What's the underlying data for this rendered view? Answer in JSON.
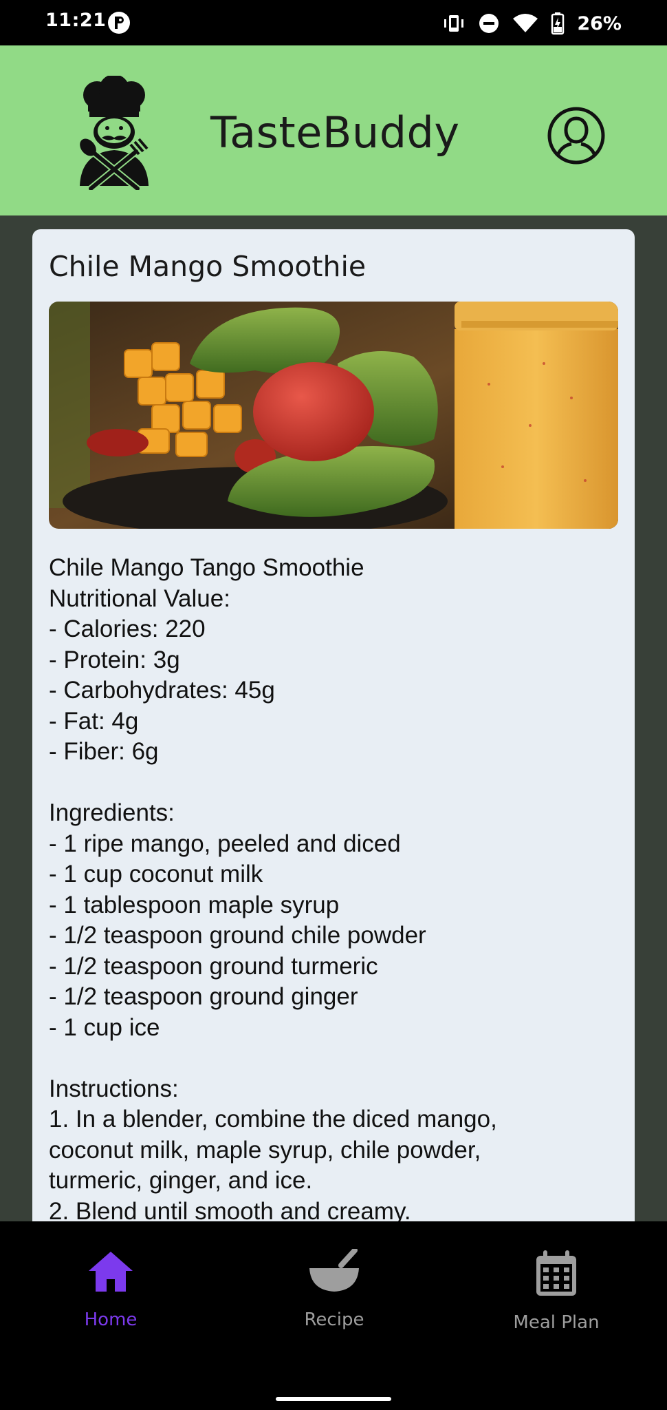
{
  "status_bar": {
    "time": "11:21",
    "battery_percent": "26%",
    "icons": [
      "app-notification-icon",
      "vibrate-icon",
      "do-not-disturb-icon",
      "wifi-icon",
      "battery-charging-icon"
    ]
  },
  "header": {
    "app_name": "TasteBuddy",
    "logo_icon": "chef-logo-icon",
    "profile_icon": "profile-icon",
    "background_color": "#91da86"
  },
  "recipe": {
    "title": "Chile Mango Smoothie",
    "image_alt": "Chile mango smoothie with mangoes, peppers and tomato",
    "lines": [
      "Chile Mango Tango Smoothie",
      "Nutritional Value:",
      "- Calories: 220",
      "- Protein: 3g",
      "- Carbohydrates: 45g",
      "- Fat: 4g",
      "- Fiber: 6g",
      "",
      "Ingredients:",
      "- 1 ripe mango, peeled and diced",
      "- 1 cup coconut milk",
      "- 1 tablespoon maple syrup",
      "- 1/2 teaspoon ground chile powder",
      "- 1/2 teaspoon ground turmeric",
      "- 1/2 teaspoon ground ginger",
      "- 1 cup ice",
      "",
      "Instructions:",
      "1. In a blender, combine the diced mango,",
      "coconut milk, maple syrup, chile powder,",
      "turmeric, ginger, and ice.",
      "2. Blend until smooth and creamy."
    ]
  },
  "bottom_nav": {
    "items": [
      {
        "label": "Home",
        "icon": "home-icon",
        "active": true
      },
      {
        "label": "Recipe",
        "icon": "mortar-bowl-icon",
        "active": false
      },
      {
        "label": "Meal Plan",
        "icon": "calendar-icon",
        "active": false
      }
    ],
    "active_color": "#7c3aed",
    "inactive_color": "#9e9e9e"
  }
}
